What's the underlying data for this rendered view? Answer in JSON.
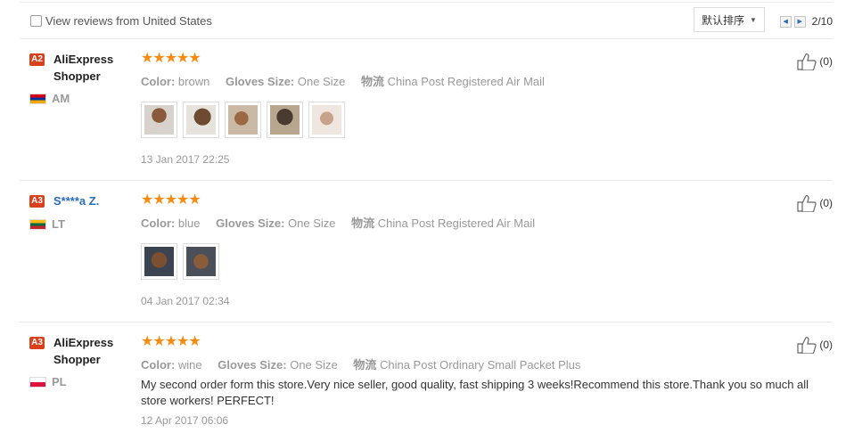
{
  "toolbar": {
    "filter_label": "View reviews from United States",
    "sort_label": "默认排序",
    "page_indicator": "2/10"
  },
  "reviews": [
    {
      "level": "A2",
      "level_color": "#d9411d",
      "user": "AliExpress Shopper",
      "country": "AM",
      "rating": "★★★★★",
      "color_label": "Color:",
      "color_value": "brown",
      "size_label": "Gloves Size:",
      "size_value": "One Size",
      "ship_label": "物流",
      "ship_value": "China Post Registered Air Mail",
      "photo_count": 5,
      "date": "13 Jan 2017 22:25",
      "helpful": "(0)"
    },
    {
      "level": "A3",
      "level_color": "#d9411d",
      "user": "S****a Z.",
      "country": "LT",
      "rating": "★★★★★",
      "color_label": "Color:",
      "color_value": "blue",
      "size_label": "Gloves Size:",
      "size_value": "One Size",
      "ship_label": "物流",
      "ship_value": "China Post Registered Air Mail",
      "photo_count": 2,
      "date": "04 Jan 2017 02:34",
      "helpful": "(0)"
    },
    {
      "level": "A3",
      "level_color": "#d9411d",
      "user": "AliExpress Shopper",
      "country": "PL",
      "rating": "★★★★★",
      "color_label": "Color:",
      "color_value": "wine",
      "size_label": "Gloves Size:",
      "size_value": "One Size",
      "ship_label": "物流",
      "ship_value": "China Post Ordinary Small Packet Plus",
      "text": "My second order form this store.Very nice seller, good quality, fast shipping 3 weeks!Recommend this store.Thank you so much all store workers! PERFECT!",
      "date": "12 Apr 2017 06:06",
      "helpful": "(0)"
    }
  ]
}
